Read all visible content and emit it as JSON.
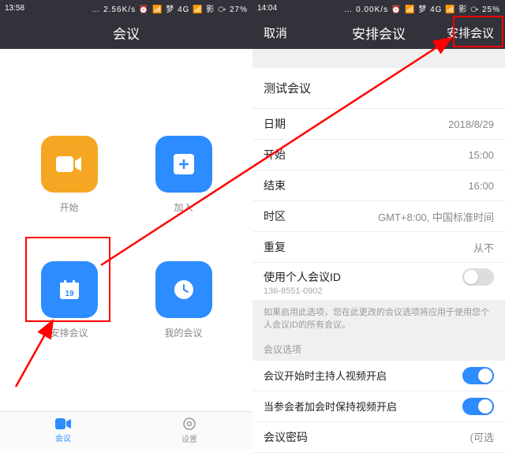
{
  "left": {
    "status": {
      "time": "13:58",
      "icons": "… 2.56K/s ⏰ 📶 梦 4G 📶 影 ⧂ 27%"
    },
    "headerTitle": "会议",
    "tiles": {
      "start": "开始",
      "join": "加入",
      "schedule": "安排会议",
      "mine": "我的会议"
    },
    "tabs": {
      "meeting": "会议",
      "settings": "设置"
    }
  },
  "right": {
    "status": {
      "time": "14:04",
      "icons": "… 0.00K/s ⏰ 📶 梦 4G 📶 影 ⧂ 25%"
    },
    "header": {
      "cancel": "取消",
      "title": "安排会议",
      "confirm": "安排会议"
    },
    "form": {
      "titleRow": "测试会议",
      "date": {
        "label": "日期",
        "value": "2018/8/29"
      },
      "start": {
        "label": "开始",
        "value": "15:00"
      },
      "end": {
        "label": "结束",
        "value": "16:00"
      },
      "tz": {
        "label": "时区",
        "value": "GMT+8:00, 中国标准时间"
      },
      "repeat": {
        "label": "重复",
        "value": "从不"
      },
      "pmi": {
        "label": "使用个人会议ID",
        "sub": "136-8551-0902"
      },
      "note": "如果启用此选项，您在此更改的会议选项将应用于使用您个人会议ID的所有会议。",
      "optionsHeader": "会议选项",
      "hostVideo": "会议开始时主持人视频开启",
      "attendeeVideo": "当参会者加会时保持视频开启",
      "password": {
        "label": "会议密码",
        "value": "(可选"
      }
    }
  }
}
